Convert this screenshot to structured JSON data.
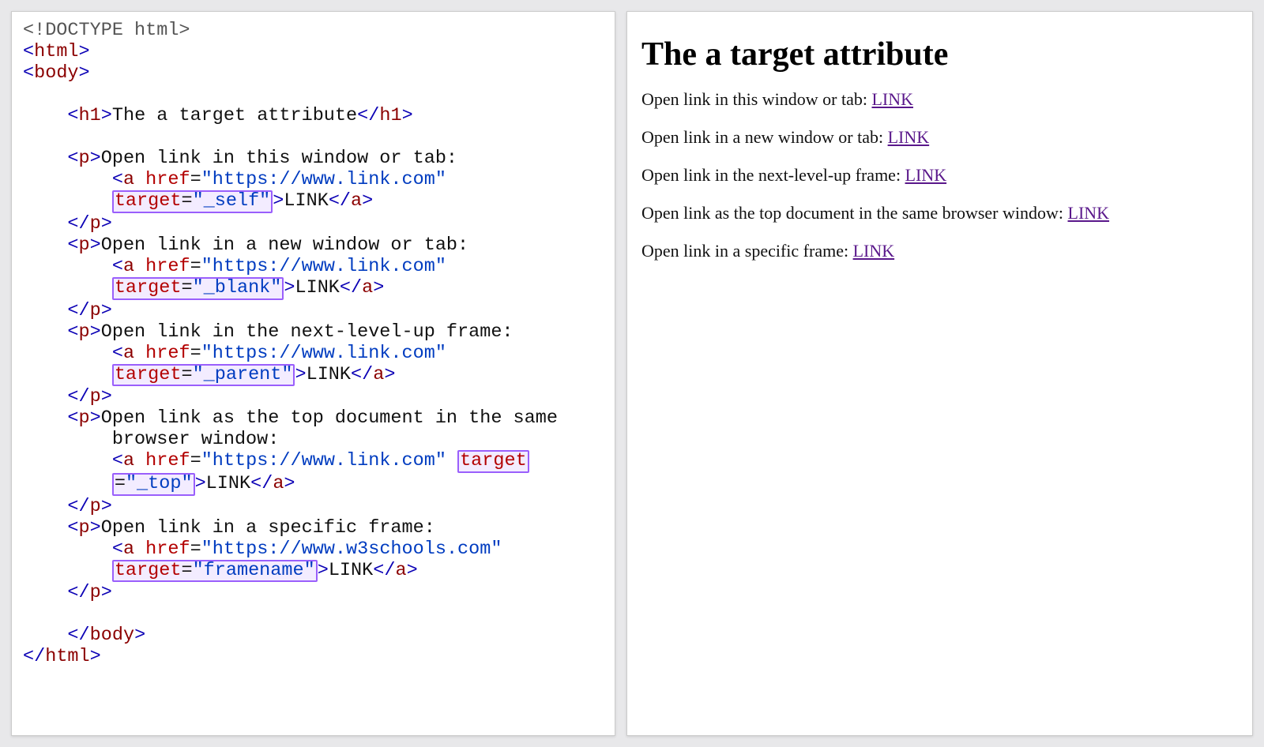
{
  "code": {
    "doctype": "<!DOCTYPE html>",
    "html_open": "html",
    "body_open": "body",
    "h1_open": "h1",
    "h1_text": "The a target attribute",
    "h1_close": "h1",
    "p": "p",
    "a": "a",
    "href_attr": "href",
    "target_attr": "target",
    "eq": "=",
    "link_url_q": "\"https://www.link.com\"",
    "w3_url_q": "\"https://www.w3schools.com\"",
    "val_self": "\"_self\"",
    "val_blank": "\"_blank\"",
    "val_parent": "\"_parent\"",
    "val_top": "\"_top\"",
    "val_framename": "\"framename\"",
    "link_text": "LINK",
    "para1": "Open link in this window or tab:",
    "para2": "Open link in a new window or tab:",
    "para3": "Open link in the next-level-up frame:",
    "para4_a": "Open link as the top document in the same",
    "para4_b": "browser window:",
    "para5": "Open link in a specific frame:",
    "body_close": "body",
    "html_close": "html"
  },
  "preview": {
    "heading": "The a target attribute",
    "items": [
      {
        "text": "Open link in this window or tab: ",
        "link": "LINK"
      },
      {
        "text": "Open link in a new window or tab: ",
        "link": "LINK"
      },
      {
        "text": "Open link in the next-level-up frame: ",
        "link": "LINK"
      },
      {
        "text": "Open link as the top document in the same browser window: ",
        "link": "LINK"
      },
      {
        "text": "Open link in a specific frame: ",
        "link": "LINK"
      }
    ]
  }
}
